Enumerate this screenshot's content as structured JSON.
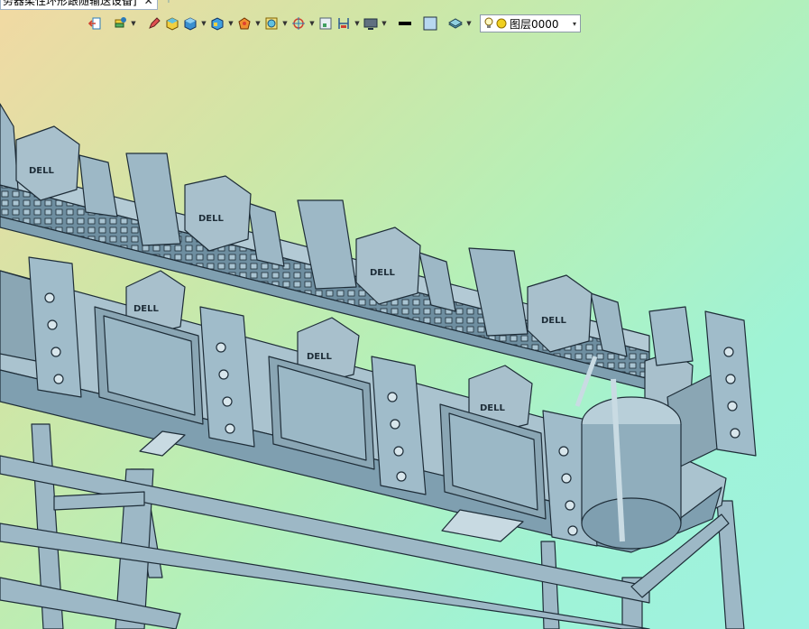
{
  "document_tab": {
    "title": "务器柔性环形跟随输送设备]",
    "close": "✕",
    "new_tab": "+"
  },
  "toolbar": {
    "tools": [
      {
        "id": "exit",
        "icon": "exit-icon"
      },
      {
        "id": "layers",
        "icon": "layers-icon",
        "dropdown": true
      },
      {
        "id": "pencil",
        "icon": "pencil-icon"
      },
      {
        "id": "solid",
        "icon": "solid-box-icon"
      },
      {
        "id": "box",
        "icon": "cube-icon",
        "dropdown": true
      },
      {
        "id": "view",
        "icon": "view-cube-icon",
        "dropdown": true
      },
      {
        "id": "shade",
        "icon": "shade-icon",
        "dropdown": true
      },
      {
        "id": "section",
        "icon": "section-icon",
        "dropdown": true
      },
      {
        "id": "target",
        "icon": "target-icon",
        "dropdown": true
      },
      {
        "id": "measure",
        "icon": "measure-icon"
      },
      {
        "id": "dimension",
        "icon": "dimension-icon",
        "dropdown": true
      },
      {
        "id": "display",
        "icon": "display-icon",
        "dropdown": true
      },
      {
        "id": "line",
        "icon": "line-color-icon"
      },
      {
        "id": "fill",
        "icon": "fill-color-icon"
      },
      {
        "id": "plane",
        "icon": "plane-icon",
        "dropdown": true
      }
    ],
    "layer_select": {
      "value": "图层0000",
      "arrow": "▾"
    }
  },
  "colors": {
    "bg_top_left": "#f2d9a3",
    "bg_mid": "#b5f0b8",
    "bg_right": "#9ff2e2",
    "model": "#8fb0c0",
    "edge": "#1e2d38"
  }
}
